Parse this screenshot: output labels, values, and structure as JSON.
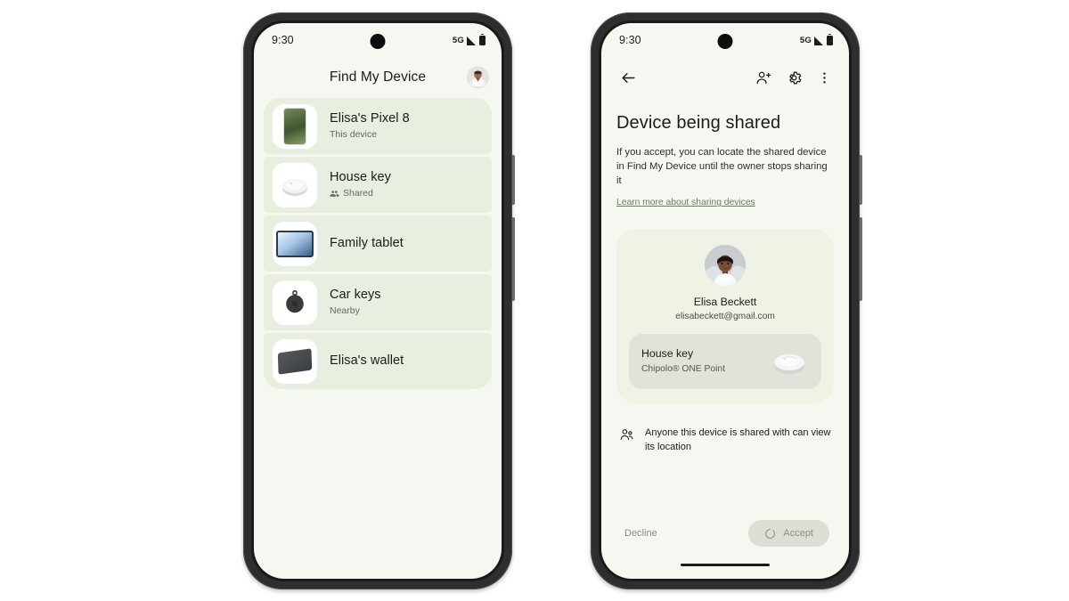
{
  "left_phone": {
    "status_bar": {
      "time": "9:30",
      "network": "5G",
      "signal_icon": "signal-triangle-icon",
      "battery_icon": "battery-icon"
    },
    "app_bar": {
      "title": "Find My Device",
      "avatar": "account-avatar"
    },
    "devices": [
      {
        "name": "Elisa's Pixel 8",
        "subtitle": "This device",
        "sub_icon": null,
        "thumb": "pixel-phone-thumbnail"
      },
      {
        "name": "House key",
        "subtitle": "Shared",
        "sub_icon": "people-icon",
        "thumb": "chipolo-tracker-thumbnail"
      },
      {
        "name": "Family tablet",
        "subtitle": "",
        "sub_icon": null,
        "thumb": "tablet-thumbnail"
      },
      {
        "name": "Car keys",
        "subtitle": "Nearby",
        "sub_icon": null,
        "thumb": "tile-tracker-thumbnail"
      },
      {
        "name": "Elisa's wallet",
        "subtitle": "",
        "sub_icon": null,
        "thumb": "wallet-thumbnail"
      }
    ]
  },
  "right_phone": {
    "status_bar": {
      "time": "9:30",
      "network": "5G",
      "signal_icon": "signal-triangle-icon",
      "battery_icon": "battery-icon"
    },
    "app_bar": {
      "back_icon": "arrow-back-icon",
      "add_person_icon": "person-add-icon",
      "settings_icon": "gear-icon",
      "overflow_icon": "more-vert-icon"
    },
    "heading": "Device being shared",
    "description": "If you accept, you can locate the shared device in Find My Device until the owner stops sharing it",
    "learn_more": "Learn more about sharing devices",
    "share_card": {
      "owner_avatar": "owner-avatar-photo",
      "owner_name": "Elisa Beckett",
      "owner_email": "elisabeckett@gmail.com",
      "item_name": "House key",
      "item_model": "Chipolo® ONE Point",
      "item_image": "chipolo-tracker-image"
    },
    "note": {
      "icon": "people-shared-icon",
      "text": "Anyone this device is shared with can view its location"
    },
    "actions": {
      "decline_label": "Decline",
      "accept_label": "Accept",
      "accept_spinner_icon": "loading-spinner-icon"
    }
  },
  "colors": {
    "screen_bg": "#f5f8f0",
    "list_item_bg": "#e8eee0",
    "share_card_bg": "#eef3e6",
    "item_card_bg": "#e0e3da",
    "accept_button_bg": "#dcdfd6",
    "text_primary": "#1b1c18",
    "text_secondary": "#666666",
    "link": "#6d7a66",
    "frame": "#2e2e2e"
  }
}
